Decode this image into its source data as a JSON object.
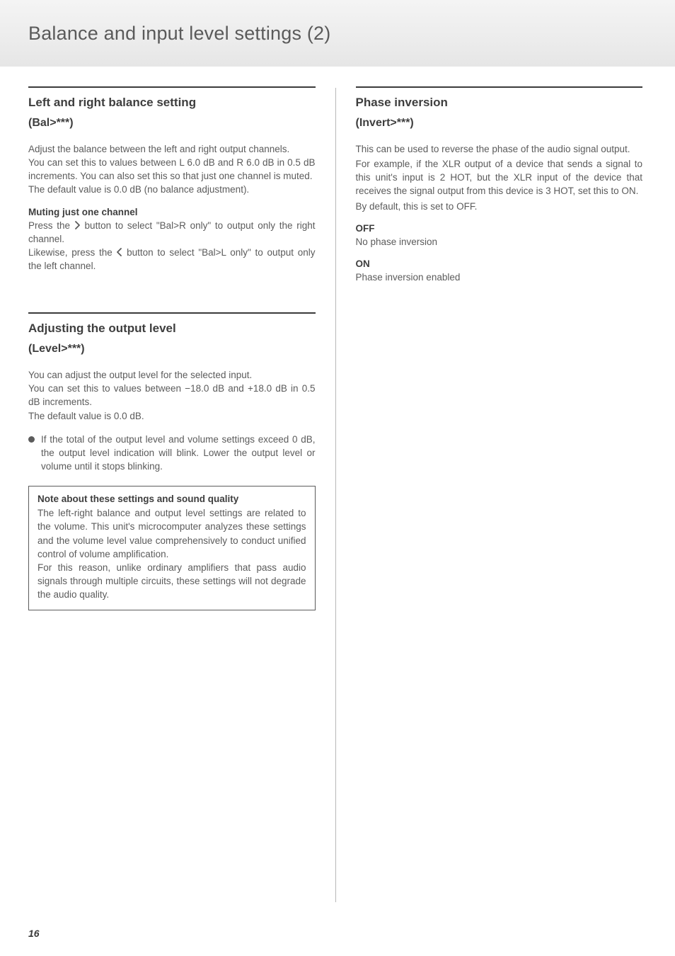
{
  "header": {
    "title": "Balance and input level settings (2)"
  },
  "left": {
    "balance": {
      "title": "Left and right balance setting",
      "sub": "(Bal>***)",
      "p1": "Adjust the balance between the left and right output channels.",
      "p2": "You can set this to values between L 6.0 dB and R 6.0 dB in 0.5 dB increments. You can also set this so that just one channel is muted.",
      "p3": "The default value is 0.0 dB (no balance adjustment).",
      "mute_head": "Muting just one channel",
      "mute_p1a": "Press the ",
      "mute_p1b": " button to select \"Bal>R only\" to output only the right channel.",
      "mute_p2a": "Likewise, press the ",
      "mute_p2b": " button to select \"Bal>L only\" to output only the left channel."
    },
    "level": {
      "title": "Adjusting the output level",
      "sub": "(Level>***)",
      "p1": "You can adjust the output level for the selected input.",
      "p2": "You can set this to values between −18.0 dB and +18.0 dB in 0.5 dB increments.",
      "p3": "The default value is 0.0 dB.",
      "bullet": "If the total of the output level and volume settings exceed 0 dB, the output level indication will blink. Lower the output level or volume until it stops blinking.",
      "note_head": "Note about these settings and sound quality",
      "note_p1": "The left-right balance and output level settings are related to the volume. This unit's microcomputer analyzes these settings and the volume level value comprehensively to conduct unified control of volume amplification.",
      "note_p2": "For this reason, unlike ordinary amplifiers that pass audio signals through multiple circuits, these settings will not degrade the audio quality."
    }
  },
  "right": {
    "phase": {
      "title": "Phase inversion",
      "sub": "(Invert>***)",
      "p1": "This can be used to reverse the phase of the audio signal output.",
      "p2": "For example, if the XLR output of a device that sends a signal to this unit's input is 2 HOT, but the XLR input of the device that receives the signal output from this device is 3 HOT, set this to ON.",
      "p3": "By default, this is set to OFF.",
      "off_head": "OFF",
      "off_body": "No phase inversion",
      "on_head": "ON",
      "on_body": "Phase inversion enabled"
    }
  },
  "page_number": "16"
}
